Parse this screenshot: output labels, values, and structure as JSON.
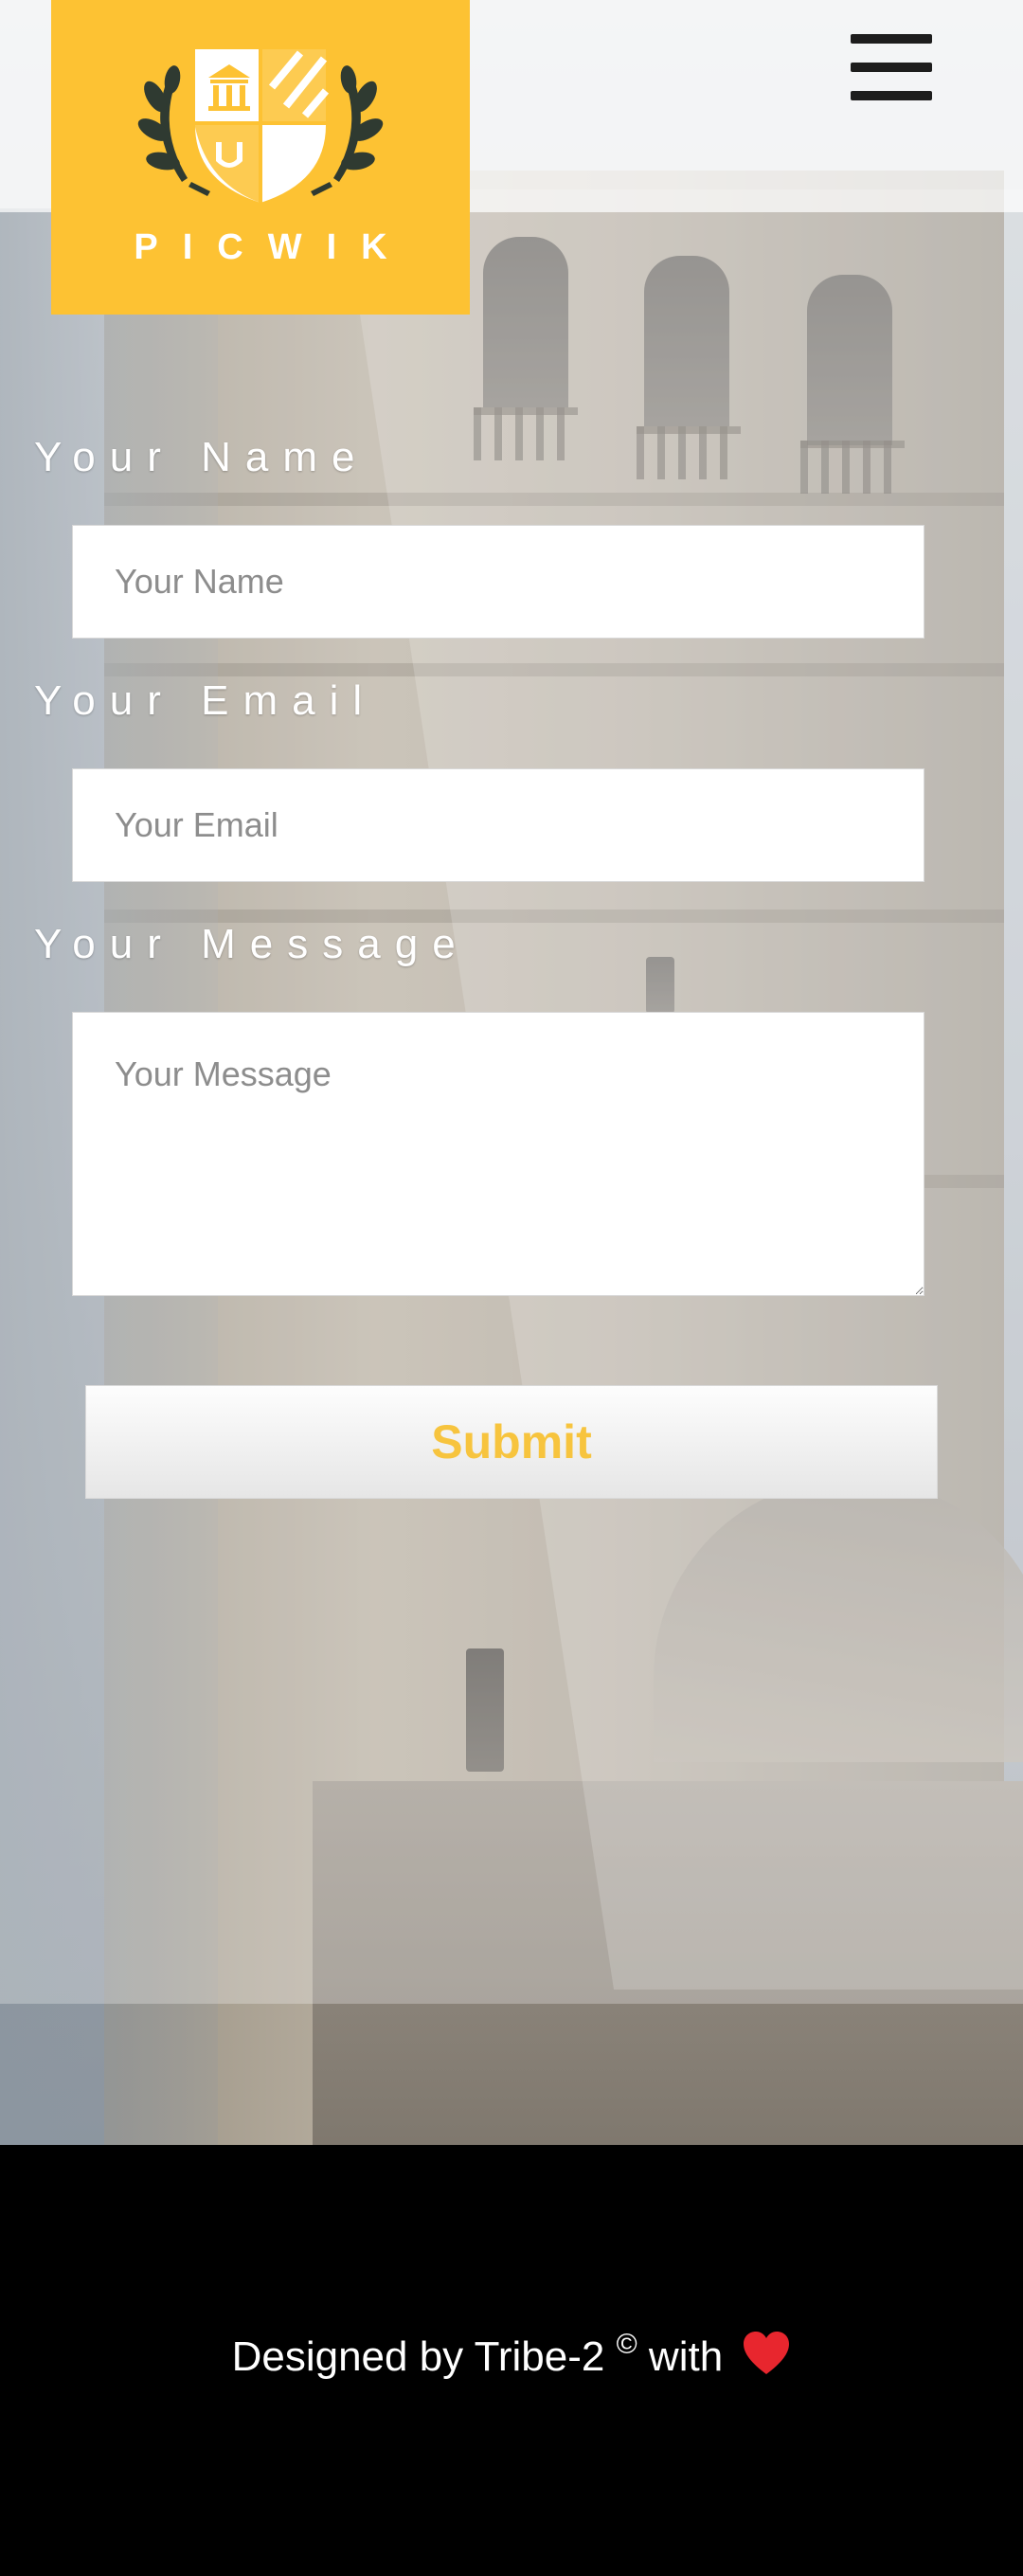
{
  "header": {
    "logo_text": "PICWIK",
    "menu_icon": "hamburger-menu-icon"
  },
  "form": {
    "name": {
      "label": "Your Name",
      "placeholder": "Your Name",
      "value": ""
    },
    "email": {
      "label": "Your Email",
      "placeholder": "Your Email",
      "value": ""
    },
    "message": {
      "label": "Your Message",
      "placeholder": "Your Message",
      "value": ""
    },
    "submit_label": "Submit"
  },
  "footer": {
    "text_prefix": "Designed by Tribe-2 ",
    "copyright_symbol": "©",
    "text_suffix": " with",
    "heart_icon": "heart-icon"
  },
  "colors": {
    "brand_yellow": "#fdc233",
    "submit_text": "#f7c43e",
    "heart": "#e8262e",
    "footer_bg": "#000000"
  }
}
